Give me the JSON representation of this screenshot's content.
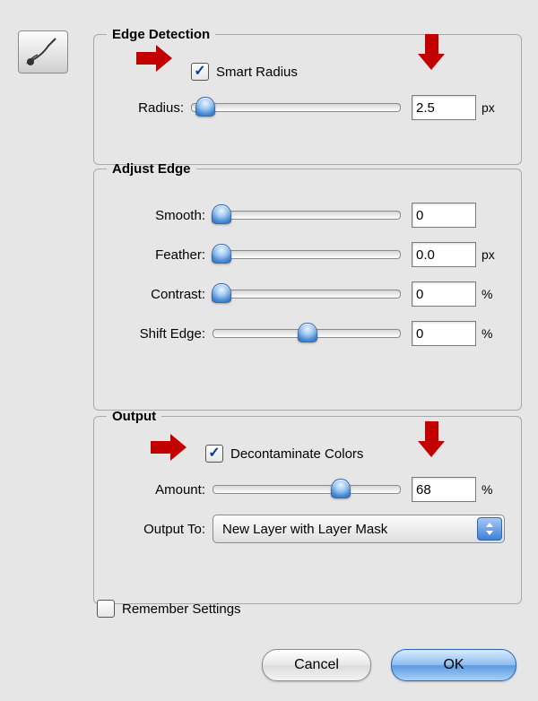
{
  "tool": {
    "name": "refine-brush-icon"
  },
  "edge_detection": {
    "legend": "Edge Detection",
    "smart_radius_label": "Smart Radius",
    "smart_radius_checked": true,
    "radius_label": "Radius:",
    "radius_value": "2.5",
    "radius_unit": "px",
    "radius_thumb_pct": 6
  },
  "adjust_edge": {
    "legend": "Adjust Edge",
    "smooth_label": "Smooth:",
    "smooth_value": "0",
    "smooth_thumb_pct": 4,
    "feather_label": "Feather:",
    "feather_value": "0.0",
    "feather_unit": "px",
    "feather_thumb_pct": 4,
    "contrast_label": "Contrast:",
    "contrast_value": "0",
    "contrast_unit": "%",
    "contrast_thumb_pct": 4,
    "shift_label": "Shift Edge:",
    "shift_value": "0",
    "shift_unit": "%",
    "shift_thumb_pct": 50
  },
  "output": {
    "legend": "Output",
    "decontaminate_label": "Decontaminate Colors",
    "decontaminate_checked": true,
    "amount_label": "Amount:",
    "amount_value": "68",
    "amount_unit": "%",
    "amount_thumb_pct": 68,
    "output_to_label": "Output To:",
    "output_to_value": "New Layer with Layer Mask"
  },
  "remember": {
    "label": "Remember Settings",
    "checked": false
  },
  "buttons": {
    "cancel": "Cancel",
    "ok": "OK"
  },
  "annotations": {
    "indicators": [
      "smart-radius-checkbox",
      "radius-value",
      "decontaminate-checkbox",
      "amount-value"
    ]
  }
}
